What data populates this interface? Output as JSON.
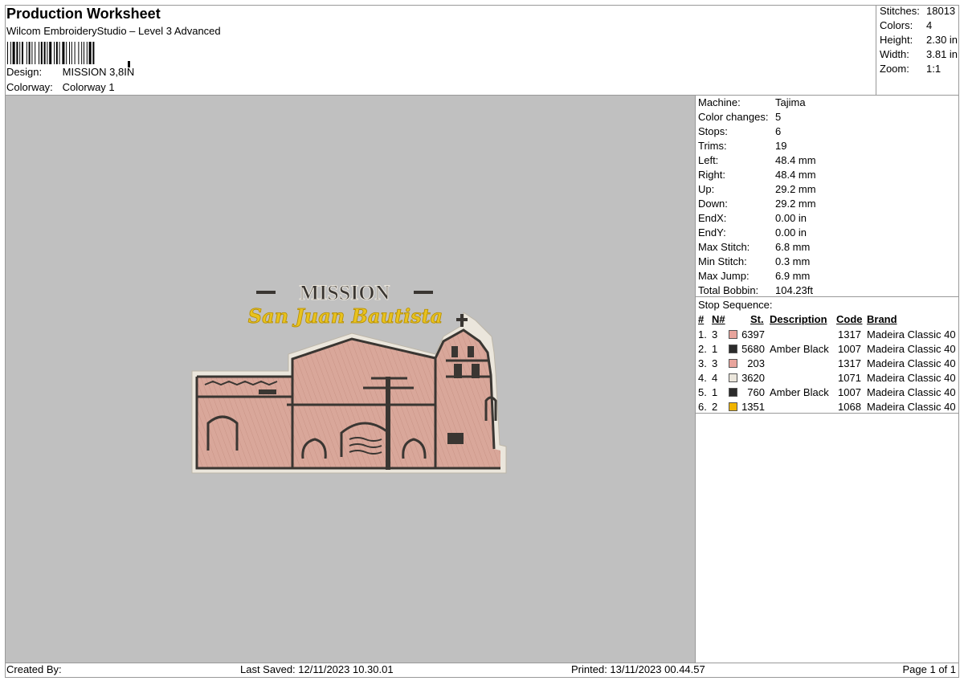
{
  "header": {
    "title": "Production Worksheet",
    "subtitle": "Wilcom EmbroideryStudio – Level 3 Advanced",
    "design_label": "Design:",
    "design_value": "MISSION 3,8IN",
    "colorway_label": "Colorway:",
    "colorway_value": "Colorway 1"
  },
  "summary": [
    {
      "label": "Stitches:",
      "value": "18013"
    },
    {
      "label": "Colors:",
      "value": "4"
    },
    {
      "label": "Height:",
      "value": "2.30 in"
    },
    {
      "label": "Width:",
      "value": "3.81 in"
    },
    {
      "label": "Zoom:",
      "value": "1:1"
    }
  ],
  "info": [
    {
      "label": "Machine:",
      "value": "Tajima"
    },
    {
      "label": "Color changes:",
      "value": "5"
    },
    {
      "label": "Stops:",
      "value": "6"
    },
    {
      "label": "Trims:",
      "value": "19"
    },
    {
      "label": "Left:",
      "value": "48.4 mm"
    },
    {
      "label": "Right:",
      "value": "48.4 mm"
    },
    {
      "label": "Up:",
      "value": "29.2 mm"
    },
    {
      "label": "Down:",
      "value": "29.2 mm"
    },
    {
      "label": "EndX:",
      "value": "0.00 in"
    },
    {
      "label": "EndY:",
      "value": "0.00 in"
    },
    {
      "label": "Max Stitch:",
      "value": "6.8 mm"
    },
    {
      "label": "Min Stitch:",
      "value": "0.3 mm"
    },
    {
      "label": "Max Jump:",
      "value": "6.9 mm"
    },
    {
      "label": "Total Bobbin:",
      "value": "104.23ft"
    }
  ],
  "stops": {
    "title": "Stop Sequence:",
    "columns": {
      "num": "#",
      "n": "N#",
      "st": "St.",
      "description": "Description",
      "code": "Code",
      "brand": "Brand"
    },
    "rows": [
      {
        "num": "1.",
        "n": "3",
        "color": "#e8a49c",
        "st": "6397",
        "description": "",
        "code": "1317",
        "brand": "Madeira Classic 40"
      },
      {
        "num": "2.",
        "n": "1",
        "color": "#2b2b2b",
        "st": "5680",
        "description": "Amber Black",
        "code": "1007",
        "brand": "Madeira Classic 40"
      },
      {
        "num": "3.",
        "n": "3",
        "color": "#e8a49c",
        "st": "203",
        "description": "",
        "code": "1317",
        "brand": "Madeira Classic 40"
      },
      {
        "num": "4.",
        "n": "4",
        "color": "#ebe6dc",
        "st": "3620",
        "description": "",
        "code": "1071",
        "brand": "Madeira Classic 40"
      },
      {
        "num": "5.",
        "n": "1",
        "color": "#2b2b2b",
        "st": "760",
        "description": "Amber Black",
        "code": "1007",
        "brand": "Madeira Classic 40"
      },
      {
        "num": "6.",
        "n": "2",
        "color": "#f0b400",
        "st": "1351",
        "description": "",
        "code": "1068",
        "brand": "Madeira Classic 40"
      }
    ]
  },
  "design": {
    "title_text": "MISSION",
    "script_text": "San Juan Bautista"
  },
  "footer": {
    "created_by": "Created By:",
    "last_saved": "Last Saved: 12/11/2023 10.30.01",
    "printed": "Printed: 13/11/2023 00.44.57",
    "page": "Page 1 of 1"
  }
}
